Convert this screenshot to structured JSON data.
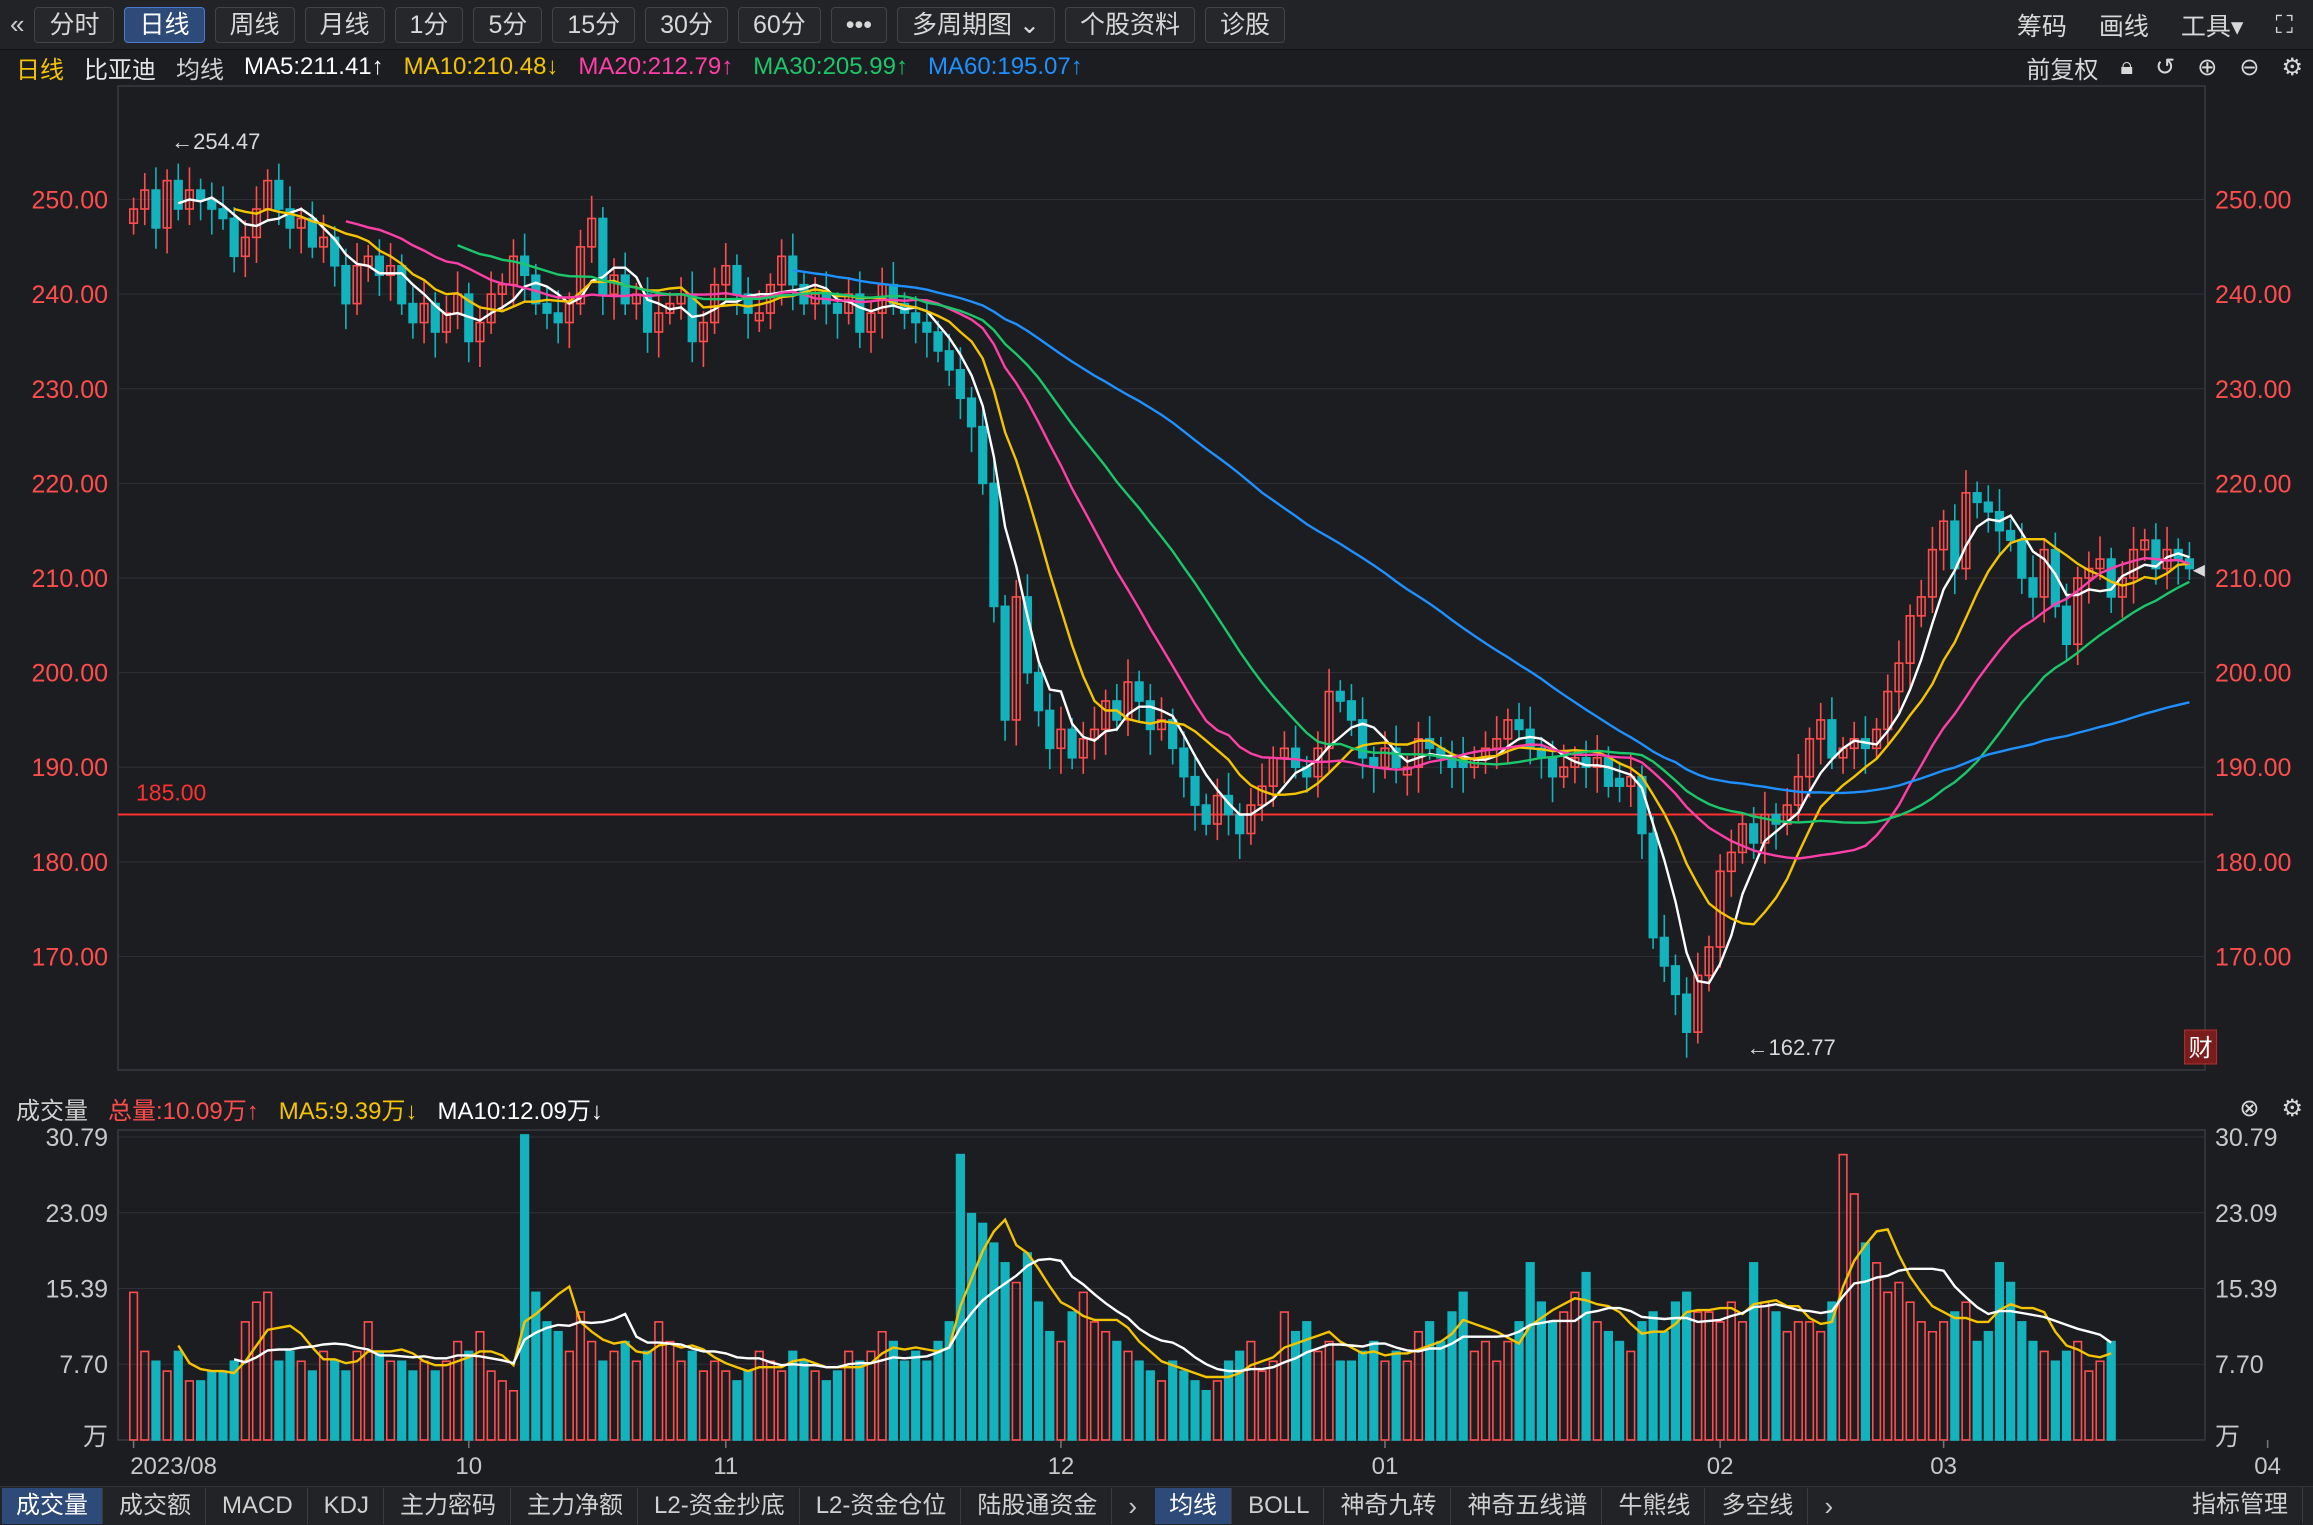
{
  "toolbar": {
    "collapse_icon": "double-chevron-left-icon",
    "periods": [
      "分时",
      "日线",
      "周线",
      "月线",
      "1分",
      "5分",
      "15分",
      "30分",
      "60分"
    ],
    "active_period": "日线",
    "more_label": "•••",
    "multi_period": "多周期图",
    "stock_info": "个股资料",
    "diagnose": "诊股",
    "right": [
      "筹码",
      "画线",
      "工具"
    ],
    "fullscreen_icon": "fullscreen-icon"
  },
  "ma_header": {
    "period": "日线",
    "stock": "比亚迪",
    "indicator": "均线",
    "ma5": "MA5:211.41↑",
    "ma10": "MA10:210.48↓",
    "ma20": "MA20:212.79↑",
    "ma30": "MA30:205.99↑",
    "ma60": "MA60:195.07↑",
    "adjust": "前复权"
  },
  "vol_header": {
    "label": "成交量",
    "total": "总量:10.09万↑",
    "ma5": "MA5:9.39万↓",
    "ma10": "MA10:12.09万↓"
  },
  "colors": {
    "up": "#ff4d4d",
    "down": "#13b3be",
    "ma5": "#ffffff",
    "ma10": "#f5c400",
    "ma20": "#ff3fa8",
    "ma30": "#1bc76a",
    "ma60": "#1e90ff",
    "hline": "#ff3030"
  },
  "chart_data": {
    "type": "candlestick",
    "price_axis": {
      "ylim": [
        158,
        262
      ],
      "ticks": [
        170,
        180,
        190,
        200,
        210,
        220,
        230,
        240,
        250
      ],
      "tick_labels": [
        "170.00",
        "180.00",
        "190.00",
        "200.00",
        "210.00",
        "220.00",
        "230.00",
        "240.00",
        "250.00"
      ]
    },
    "volume_axis": {
      "ylim": [
        0,
        31.5
      ],
      "tick_labels": [
        "30.79",
        "23.09",
        "15.39",
        "7.70",
        "万"
      ],
      "ticks": [
        30.79,
        23.09,
        15.39,
        7.7
      ],
      "unit": "万"
    },
    "x_labels": [
      {
        "i": 0,
        "label": "2023/08"
      },
      {
        "i": 30,
        "label": "10"
      },
      {
        "i": 53,
        "label": "11"
      },
      {
        "i": 83,
        "label": "12"
      },
      {
        "i": 112,
        "label": "01"
      },
      {
        "i": 142,
        "label": "02"
      },
      {
        "i": 162,
        "label": "03"
      },
      {
        "i": 191,
        "label": "04"
      }
    ],
    "annotations": {
      "high_label": "←254.47",
      "high_value": 254.47,
      "high_index": 3,
      "low_label": "←162.77",
      "low_value": 162.77,
      "low_index": 144,
      "hline_value": 185.0,
      "hline_label": "185.00",
      "finance_marker": "财",
      "finance_index": 185
    },
    "ohlc_close": [
      249,
      251,
      247,
      252,
      249,
      251,
      250,
      249,
      248,
      244,
      246,
      249,
      252,
      249,
      247,
      248,
      245,
      246,
      243,
      239,
      243,
      244,
      242,
      243,
      239,
      237,
      239,
      236,
      238,
      240,
      235,
      237,
      240,
      241,
      244,
      242,
      239,
      238,
      237,
      239,
      245,
      248,
      240,
      242,
      239,
      240,
      236,
      238,
      239,
      240,
      235,
      237,
      241,
      243,
      240,
      238,
      238,
      241,
      244,
      241,
      239,
      240,
      239,
      238,
      240,
      236,
      238,
      241,
      239,
      238,
      237,
      236,
      234,
      232,
      229,
      226,
      220,
      207,
      195,
      208,
      200,
      196,
      192,
      194,
      191,
      193,
      194,
      197,
      195,
      199,
      197,
      194,
      195,
      192,
      189,
      186,
      184,
      187,
      185,
      183,
      186,
      188,
      191,
      192,
      190,
      189,
      192,
      198,
      197,
      195,
      191,
      190,
      192,
      190,
      190,
      193,
      192,
      191,
      190,
      190,
      191,
      192,
      193,
      195,
      194,
      192,
      191,
      189,
      190,
      191,
      190,
      191,
      188,
      188,
      189,
      183,
      172,
      169,
      166,
      162,
      168,
      171,
      179,
      181,
      184,
      182,
      185,
      184,
      186,
      189,
      193,
      195,
      191,
      192,
      193,
      192,
      194,
      198,
      201,
      206,
      208,
      213,
      216,
      211,
      219,
      218,
      217,
      215,
      214,
      210,
      208,
      213,
      207,
      203,
      210,
      211,
      212,
      208,
      210,
      213,
      214,
      211,
      213,
      212,
      211
    ],
    "volume": [
      15,
      9,
      8,
      7,
      9,
      6,
      6,
      7,
      7,
      8,
      12,
      14,
      15,
      8,
      9,
      8,
      7,
      9,
      8,
      7,
      9,
      12,
      9,
      8,
      8,
      7,
      8,
      7,
      8,
      10,
      9,
      11,
      7,
      6,
      5,
      31,
      15,
      12,
      11,
      9,
      13,
      10,
      8,
      9,
      10,
      8,
      9,
      12,
      10,
      8,
      9,
      7,
      8,
      7,
      6,
      7,
      9,
      8,
      7,
      9,
      8,
      7,
      6,
      7,
      9,
      8,
      9,
      11,
      10,
      8,
      9,
      8,
      10,
      12,
      29,
      23,
      22,
      20,
      18,
      16,
      19,
      14,
      11,
      10,
      13,
      15,
      12,
      11,
      10,
      9,
      8,
      7,
      6,
      8,
      7,
      6,
      5,
      6,
      8,
      9,
      10,
      7,
      8,
      13,
      11,
      12,
      9,
      10,
      8,
      8,
      9,
      10,
      8,
      9,
      8,
      11,
      12,
      10,
      13,
      15,
      9,
      10,
      8,
      10,
      12,
      18,
      14,
      12,
      13,
      15,
      17,
      12,
      11,
      10,
      9,
      12,
      13,
      11,
      14,
      15,
      13,
      13,
      12,
      14,
      12,
      18,
      14,
      13,
      11,
      12,
      12,
      11,
      14,
      29,
      25,
      20,
      18,
      15,
      16,
      14,
      12,
      11,
      12,
      13,
      14,
      10,
      11,
      18,
      16,
      12,
      10,
      9,
      8,
      9,
      10,
      7,
      8,
      10
    ]
  }
}
